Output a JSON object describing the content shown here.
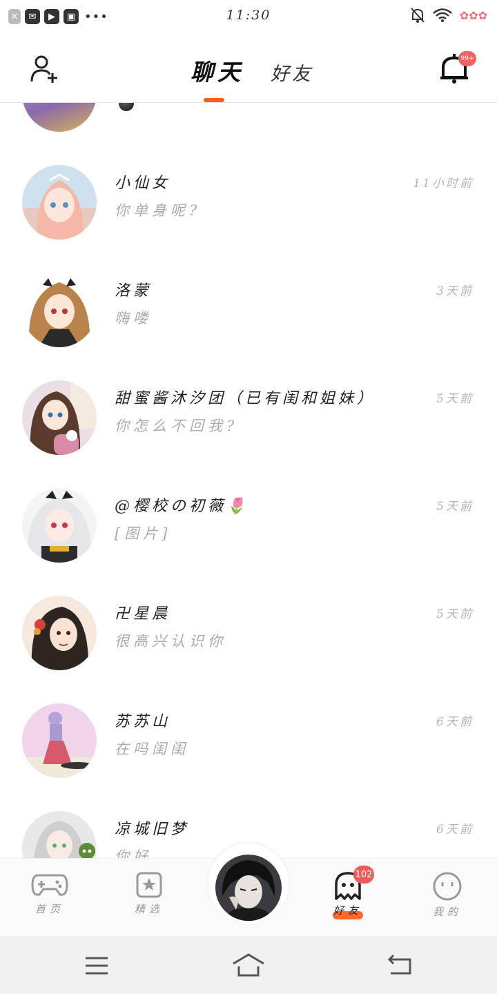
{
  "status_bar": {
    "time": "11:30",
    "left_icons": [
      "close-app-icon",
      "mail-icon",
      "video-icon",
      "gallery-icon"
    ],
    "more": "•••",
    "battery_glyph": "✿✿✿"
  },
  "header": {
    "tabs": [
      {
        "label": "聊天",
        "active": true
      },
      {
        "label": "好友",
        "active": false
      }
    ],
    "notification_badge": "99+",
    "accent_color": "#ff5a1f"
  },
  "chats": [
    {
      "name": "小仙女",
      "message": "你单身呢?",
      "time": "11小时前",
      "avatar": "avatar-pink-hair-girl"
    },
    {
      "name": "洛蒙",
      "message": "嗨喽",
      "time": "3天前",
      "avatar": "avatar-twin-tail-girl"
    },
    {
      "name": "甜蜜酱沐汐团（已有闺和姐妹）",
      "message": "你怎么不回我?",
      "time": "5天前",
      "avatar": "avatar-brown-hair-girl"
    },
    {
      "name": "@樱校の初薇🌷",
      "message": "[图片]",
      "time": "5天前",
      "avatar": "avatar-white-hair-girl"
    },
    {
      "name": "卍星晨",
      "message": "很高兴认识你",
      "time": "5天前",
      "avatar": "avatar-traditional-girl"
    },
    {
      "name": "苏苏山",
      "message": "在吗闺闺",
      "time": "6天前",
      "avatar": "avatar-chibi-figure"
    },
    {
      "name": "凉城旧梦",
      "message": "你好",
      "time": "6天前",
      "avatar": "avatar-silver-hair-boy"
    }
  ],
  "bottom_nav": {
    "items": [
      {
        "label": "首页",
        "icon": "gamepad-icon"
      },
      {
        "label": "精选",
        "icon": "star-card-icon"
      },
      {
        "label": "好友",
        "icon": "ghost-icon",
        "active": true,
        "badge": "102"
      },
      {
        "label": "我的",
        "icon": "smiley-icon"
      }
    ]
  },
  "system_nav": [
    "menu-icon",
    "home-icon",
    "back-icon"
  ]
}
